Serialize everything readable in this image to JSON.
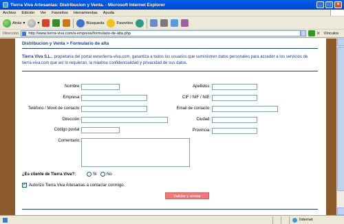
{
  "window": {
    "title": "Tierra Viva Artesanias: Distribucion y Venta. - Microsoft Internet Explorer"
  },
  "menu": [
    "Archivo",
    "Edición",
    "Ver",
    "Favoritos",
    "Herramientas",
    "Ayuda"
  ],
  "toolbar": {
    "back_label": "Atrás",
    "search_label": "Búsqueda",
    "favorites_label": "Favoritos"
  },
  "address": {
    "label": "Dirección",
    "url": "http://www.tierra-viva.com/a-empresa/formulario-de-alta.php",
    "go_label": "Ir",
    "links_label": "Vínculos"
  },
  "page": {
    "heading": "Distribucion y Venta > Formulario de alta",
    "intro_company": "Tierra Viva S.L.",
    "intro_text": ", propietaria del portal www.tierra-viva.com, garantiza a todos los usuarios que suministren datos personales para acceder a los servicios de tierra-viva.com que así lo requieran, la máxima confidencialidad y privacidad de sus datos."
  },
  "form": {
    "nombre": "Nombre:",
    "apellidos": "Apellidos:",
    "empresa": "Empresa:",
    "cif": "CIF / NIF / NIE:",
    "telefono": "Teléfono / Movil de contacto:",
    "email": "Email de contacto:",
    "direccion": "Dirección:",
    "ciudad": "Ciudad:",
    "codigo_postal": "Código postal:",
    "provincia": "Provincia:",
    "comentario": "Comentario:",
    "cliente_question": "¿Es cliente de Tierra Viva?:",
    "si": "Si",
    "no": "No",
    "autorizo": "Autorizo Tierra Viva Artesanias a contactar conmigo.",
    "submit": "Validar y enviar"
  },
  "status": {
    "zone": "Internet"
  }
}
